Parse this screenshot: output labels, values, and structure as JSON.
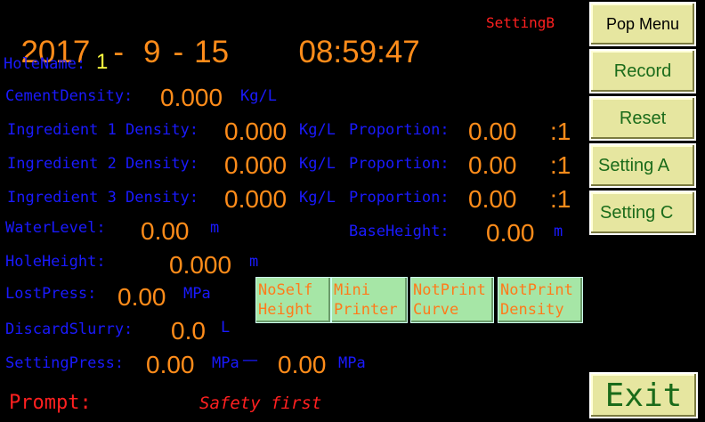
{
  "header": {
    "year": "2017",
    "month": "9",
    "day": "15",
    "date_sep": "-",
    "hour": "08",
    "minute": "59",
    "second": "47",
    "time_sep": ":",
    "mode": "SettingB"
  },
  "fields": {
    "hole_name_label": "HoleName:",
    "hole_name_value": "1",
    "cement_density_label": "CementDensity:",
    "cement_density_value": "0.000",
    "cement_density_unit": "Kg/L",
    "ingredients": [
      {
        "label": "Ingredient 1 Density:",
        "value": "0.000",
        "unit": "Kg/L",
        "proportion_label": "Proportion:",
        "proportion": "0.00",
        "ratio": ":1"
      },
      {
        "label": "Ingredient 2 Density:",
        "value": "0.000",
        "unit": "Kg/L",
        "proportion_label": "Proportion:",
        "proportion": "0.00",
        "ratio": ":1"
      },
      {
        "label": "Ingredient 3 Density:",
        "value": "0.000",
        "unit": "Kg/L",
        "proportion_label": "Proportion:",
        "proportion": "0.00",
        "ratio": ":1"
      }
    ],
    "water_level_label": "WaterLevel:",
    "water_level_value": "0.00",
    "water_level_unit": "m",
    "base_height_label": "BaseHeight:",
    "base_height_value": "0.00",
    "base_height_unit": "m",
    "hole_height_label": "HoleHeight:",
    "hole_height_value": "0.000",
    "hole_height_unit": "m",
    "lost_press_label": "LostPress:",
    "lost_press_value": "0.00",
    "lost_press_unit": "MPa",
    "discard_slurry_label": "DiscardSlurry:",
    "discard_slurry_value": "0.0",
    "discard_slurry_unit": "L",
    "setting_press_label": "SettingPress:",
    "setting_press_value1": "0.00",
    "setting_press_unit1": "MPa",
    "setting_press_dash": "—",
    "setting_press_value2": "0.00",
    "setting_press_unit2": "MPa"
  },
  "toggles": [
    {
      "line1": "NoSelf",
      "line2": "Height"
    },
    {
      "line1": "Mini",
      "line2": "Printer"
    },
    {
      "line1": "NotPrint",
      "line2": "Curve"
    },
    {
      "line1": "NotPrint",
      "line2": "Density"
    }
  ],
  "side_buttons": {
    "pop_menu": "Pop Menu",
    "record": "Record",
    "reset": "Reset",
    "setting_a": "Setting A",
    "setting_c": "Setting C"
  },
  "exit_label": "Exit",
  "prompt": {
    "label": "Prompt:",
    "message": "Safety first"
  },
  "colors": {
    "background": "#000000",
    "label": "#1a1aff",
    "value": "#ff8c1a",
    "button_face": "#e6e6a0",
    "button_text": "#1a6b1a",
    "toggle_face": "#a6e6a6",
    "prompt_red": "#ff2020"
  }
}
